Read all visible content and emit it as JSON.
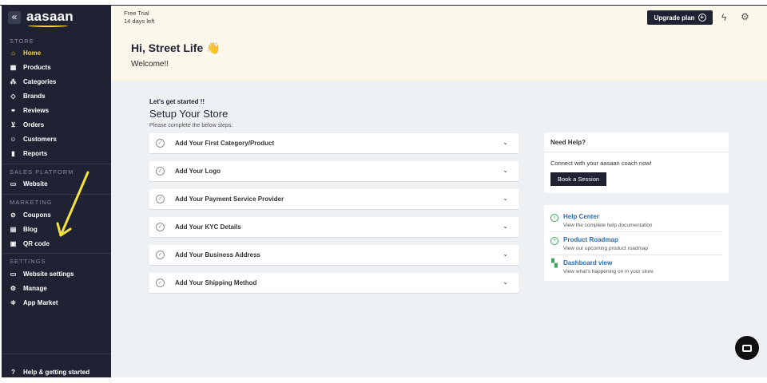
{
  "sidebar": {
    "collapse_icon": "«",
    "logo": "aasaan",
    "sections": {
      "store": "STORE",
      "sales_platform": "SALES PLATFORM",
      "marketing": "MARKETING",
      "settings": "SETTINGS"
    },
    "store_items": [
      {
        "label": "Home",
        "icon": "home-icon",
        "active": true
      },
      {
        "label": "Products",
        "icon": "grid-icon"
      },
      {
        "label": "Categories",
        "icon": "categories-icon"
      },
      {
        "label": "Brands",
        "icon": "tag-icon"
      },
      {
        "label": "Reviews",
        "icon": "link-icon"
      },
      {
        "label": "Orders",
        "icon": "cart-icon"
      },
      {
        "label": "Customers",
        "icon": "users-icon"
      },
      {
        "label": "Reports",
        "icon": "chart-icon"
      }
    ],
    "sales_items": [
      {
        "label": "Website",
        "icon": "monitor-icon"
      }
    ],
    "marketing_items": [
      {
        "label": "Coupons",
        "icon": "coupon-icon"
      },
      {
        "label": "Blog",
        "icon": "blog-icon"
      },
      {
        "label": "QR code",
        "icon": "qr-icon"
      }
    ],
    "settings_items": [
      {
        "label": "Website settings",
        "icon": "website-settings-icon"
      },
      {
        "label": "Manage",
        "icon": "gear-icon"
      },
      {
        "label": "App Market",
        "icon": "apps-icon"
      }
    ],
    "help": "Help & getting started"
  },
  "header": {
    "trial_line1": "Free Trial",
    "trial_line2": "14 days left",
    "upgrade_label": "Upgrade plan",
    "greeting": "Hi, Street Life 👋",
    "welcome": "Welcome!!"
  },
  "setup": {
    "kicker": "Let's get started !!",
    "title": "Setup Your Store",
    "subtitle": "Please complete the below steps:",
    "steps": [
      "Add Your First Category/Product",
      "Add Your Logo",
      "Add Your Payment Service Provider",
      "Add Your KYC Details",
      "Add Your Business Address",
      "Add Your Shipping Method"
    ]
  },
  "help_card": {
    "title": "Need Help?",
    "text": "Connect with your aasaan coach now!",
    "button": "Book a Session"
  },
  "resources": [
    {
      "name": "Help Center",
      "desc": "View the complete help documentation",
      "icon": "info-icon"
    },
    {
      "name": "Product Roadmap",
      "desc": "View our upcoming product roadmap",
      "icon": "plus-circle-icon"
    },
    {
      "name": "Dashboard view",
      "desc": "View what's happening on in your store",
      "icon": "dashboard-icon"
    }
  ],
  "colors": {
    "sidebar_bg": "#1f2233",
    "accent_yellow": "#f7d43c",
    "header_bg": "#fbf7ea",
    "main_bg": "#eef1f4",
    "link_blue": "#2b6cb0",
    "green": "#3ba55d"
  }
}
